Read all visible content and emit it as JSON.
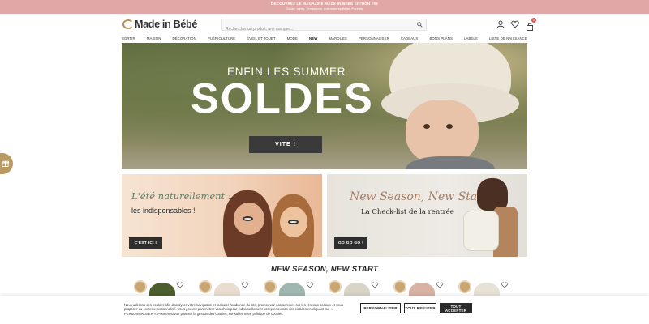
{
  "topbar": {
    "line1": "DÉCOUVREZ LE MAGAZINE MADE IN BÉBÉ ÉDITION #06",
    "line2": "Guide, idées, Tendances, événements Bébé, Parents"
  },
  "header": {
    "logo": "Made in Bébé",
    "search_placeholder": "Rechercher un produit, une marque...",
    "cart_count": "0"
  },
  "nav": [
    {
      "label": "SORTIR",
      "name": "nav-sortir"
    },
    {
      "label": "MAISON",
      "name": "nav-maison"
    },
    {
      "label": "DÉCORATION",
      "name": "nav-decoration"
    },
    {
      "label": "PUÉRICULTURE",
      "name": "nav-puericulture"
    },
    {
      "label": "ÉVEIL ET JOUET",
      "name": "nav-eveil"
    },
    {
      "label": "MODE",
      "name": "nav-mode"
    },
    {
      "label": "NEW",
      "name": "nav-new"
    },
    {
      "label": "MARQUES",
      "name": "nav-marques"
    },
    {
      "label": "PERSONNALISER",
      "name": "nav-personnaliser"
    },
    {
      "label": "CADEAUX",
      "name": "nav-cadeaux"
    },
    {
      "label": "BONS PLANS",
      "name": "nav-bons-plans"
    },
    {
      "label": "LABELS",
      "name": "nav-labels"
    },
    {
      "label": "LISTE DE NAISSANCE",
      "name": "nav-liste-naissance"
    }
  ],
  "hero": {
    "line1": "ENFIN LES SUMMER",
    "line2": "SOLDES",
    "cta": "VITE !"
  },
  "promos": [
    {
      "script": "L'été naturellement :",
      "sub": "les indispensables !",
      "cta": "C'EST ICI !"
    },
    {
      "script": "New Season, New Start",
      "sub": "La Check-list de la rentrée",
      "cta": "GO GO GO !"
    }
  ],
  "section_title": "NEW SEASON, NEW START",
  "cookie": {
    "message": "Nous utilisons des cookies afin d'analyser votre navigation et mesurer l'audience du site, promouvoir nos services sur les réseaux sociaux et vous proposer du contenu personnalisé. Vous pouvez paramétrer vos choix pour individuellement accepter ou non ces cookies en cliquant sur « PERSONNALISER ». Pour en savoir plus sur la gestion des cookies, consultez notre politique de cookies.",
    "personalize": "PERSONNALISER",
    "refuse": "TOUT REFUSER",
    "accept": "TOUT ACCEPTER"
  },
  "colors": {
    "topbar": "#e1a7a7",
    "accent_gold": "#b89a62",
    "dark_button": "#2e2e2e"
  },
  "icons": [
    "search-icon",
    "user-icon",
    "heart-icon",
    "bag-icon",
    "gift-icon"
  ]
}
